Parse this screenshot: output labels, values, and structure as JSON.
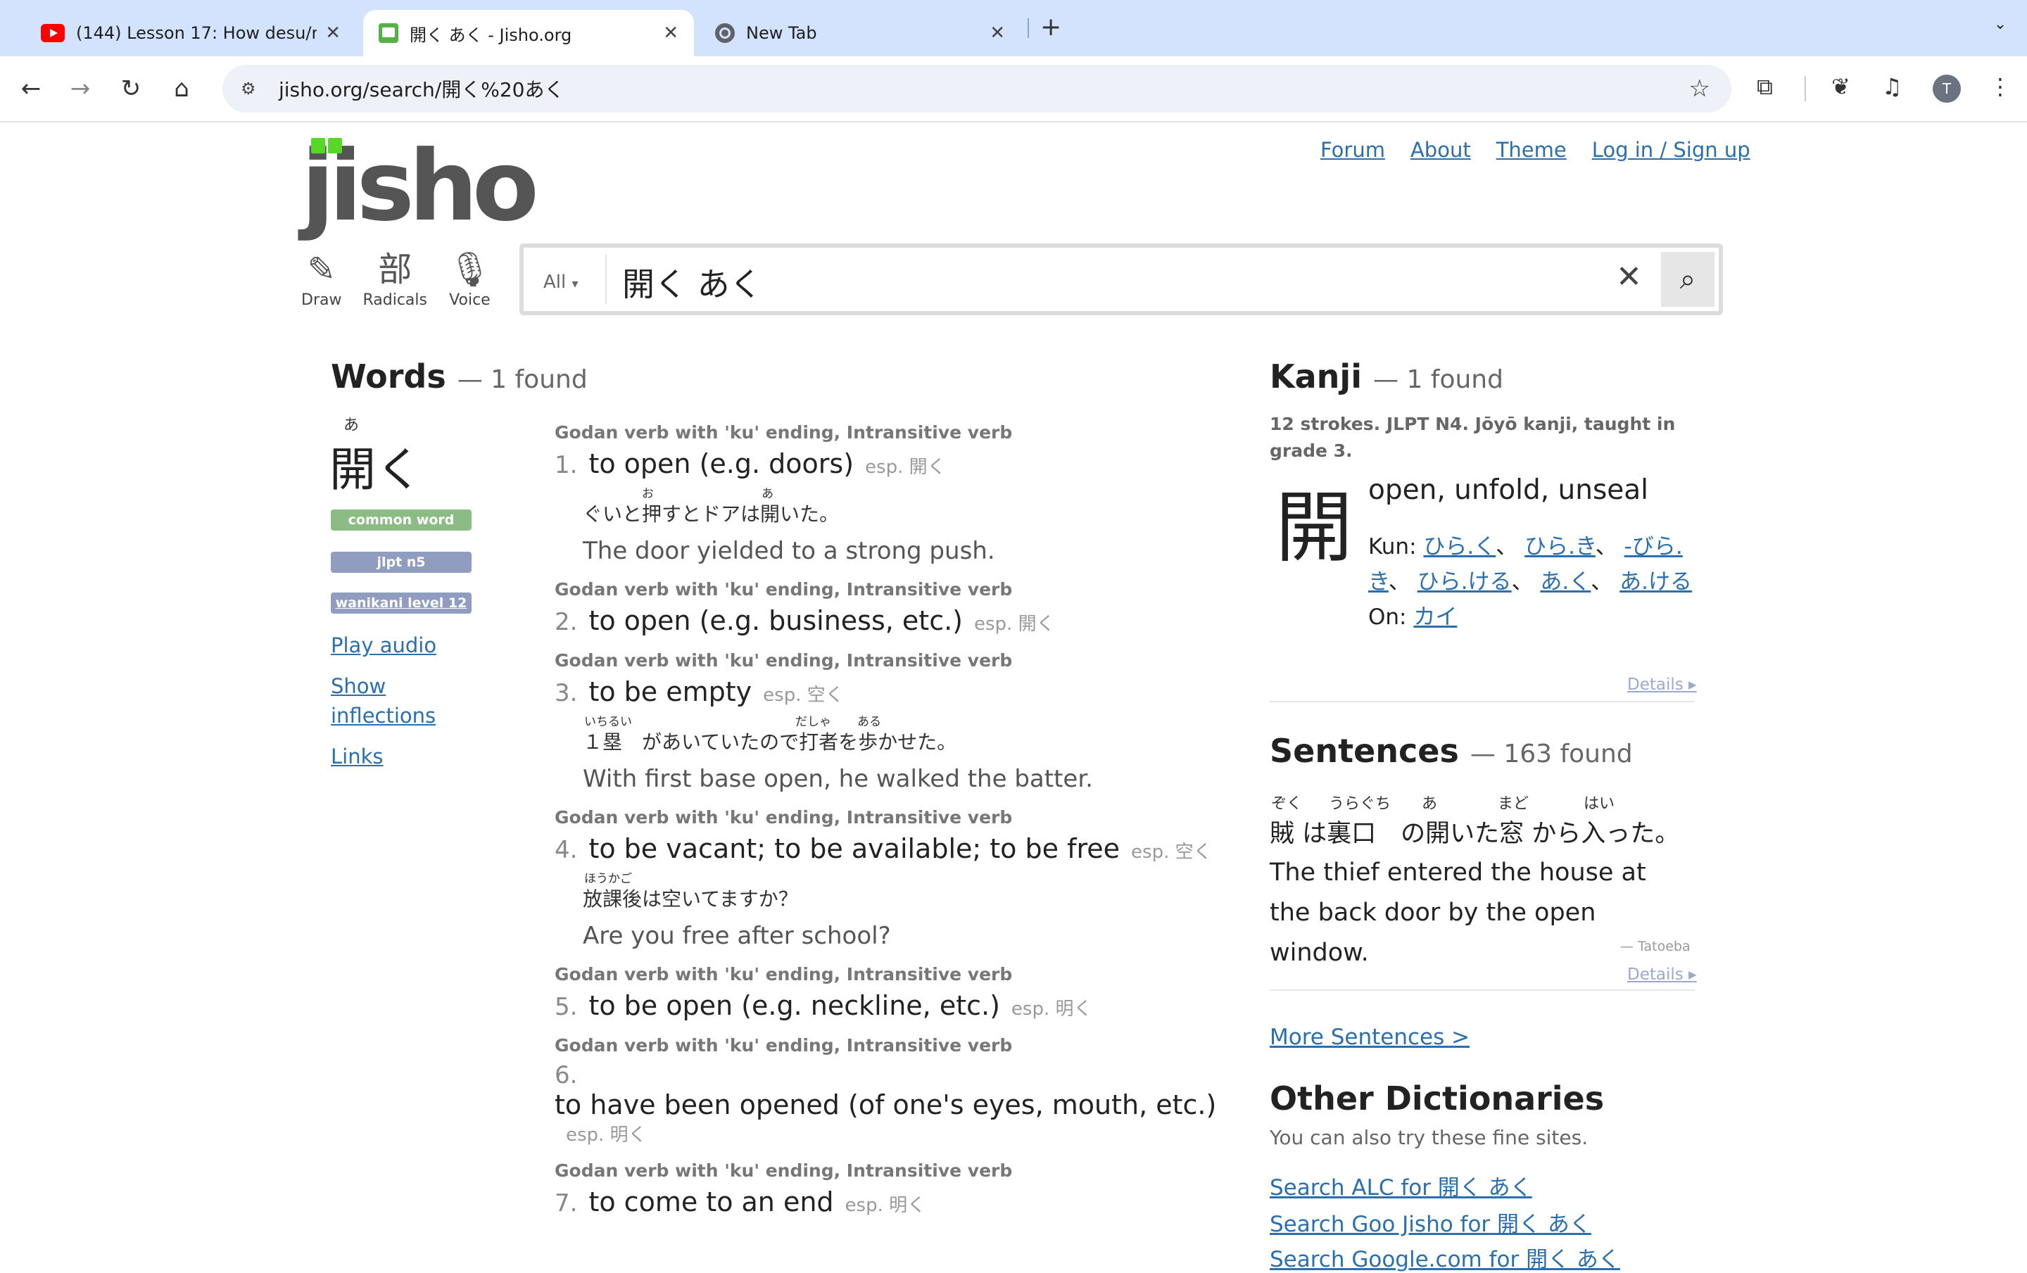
{
  "browser": {
    "tabs": [
      {
        "title": "(144) Lesson 17: How desu/m",
        "close": "✕"
      },
      {
        "title": "開く あく - Jisho.org",
        "close": "✕"
      },
      {
        "title": "New Tab",
        "close": "✕"
      }
    ],
    "new_tab": "+",
    "url": "jisho.org/search/開く%20あく",
    "avatar_letter": "T"
  },
  "site": {
    "logo": "jisho",
    "nav": [
      "Forum",
      "About",
      "Theme",
      "Log in / Sign up"
    ],
    "tools": [
      {
        "glyph": "✎",
        "label": "Draw"
      },
      {
        "glyph": "部",
        "label": "Radicals"
      },
      {
        "glyph": "🎙",
        "label": "Voice"
      }
    ],
    "search": {
      "filter": "All",
      "query": "開く あく"
    }
  },
  "words": {
    "heading": "Words",
    "count": "— 1 found",
    "furigana": "あ",
    "word": "開く",
    "tags": [
      "common word",
      "jlpt n5",
      "wanikani level 12"
    ],
    "links": [
      "Play audio",
      "Show",
      "inflections",
      "Links"
    ],
    "definitions": [
      {
        "pos": "Godan verb with 'ku' ending, Intransitive verb",
        "num": "1.",
        "meaning": "to open (e.g. doors)",
        "esp": "esp. 開く",
        "ex_jp": "ぐいと押すとドアは開いた。",
        "ex_en": "The door yielded to a strong push.",
        "ruby": [
          "お",
          "あ"
        ]
      },
      {
        "pos": "Godan verb with 'ku' ending, Intransitive verb",
        "num": "2.",
        "meaning": "to open (e.g. business, etc.)",
        "esp": "esp. 開く"
      },
      {
        "pos": "Godan verb with 'ku' ending, Intransitive verb",
        "num": "3.",
        "meaning": "to be empty",
        "esp": "esp. 空く",
        "ex_jp": "１塁　があいていたので打者を歩かせた。",
        "ex_en": "With first base open, he walked the batter.",
        "ruby": [
          "いちるい",
          "だしゃ",
          "ある"
        ]
      },
      {
        "pos": "Godan verb with 'ku' ending, Intransitive verb",
        "num": "4.",
        "meaning": "to be vacant; to be available; to be free",
        "esp": "esp. 空く",
        "ex_jp": "放課後は空いてますか？",
        "ex_en": "Are you free after school?",
        "ruby": [
          "ほうかご"
        ]
      },
      {
        "pos": "Godan verb with 'ku' ending, Intransitive verb",
        "num": "5.",
        "meaning": "to be open (e.g. neckline, etc.)",
        "esp": "esp. 明く"
      },
      {
        "pos": "Godan verb with 'ku' ending, Intransitive verb",
        "num": "6.",
        "meaning": "to have been opened (of one's eyes, mouth, etc.)",
        "esp": "esp. 明く"
      },
      {
        "pos": "Godan verb with 'ku' ending, Intransitive verb",
        "num": "7.",
        "meaning": "to come to an end",
        "esp": "esp. 明く"
      }
    ]
  },
  "kanji": {
    "heading": "Kanji",
    "count": "— 1 found",
    "info": "12 strokes. JLPT N4. Jōyō kanji, taught in grade 3.",
    "char": "開",
    "meaning": "open, unfold, unseal",
    "kun_label": "Kun:",
    "kun": [
      "ひら.く",
      "ひら.き",
      "-びら.き",
      "ひら.ける",
      "あ.く",
      "あ.ける"
    ],
    "on_label": "On:",
    "on": [
      "カイ"
    ],
    "details": "Details ▸"
  },
  "sentences": {
    "heading": "Sentences",
    "count": "— 163 found",
    "furigana": [
      "ぞく",
      "うらぐち",
      "あ",
      "まど",
      "はい"
    ],
    "japanese": "賊 は裏口　の開いた窓 から入った。",
    "english": "The thief entered the house at the back door by the open window.",
    "source": "— Tatoeba",
    "details": "Details ▸",
    "more": "More Sentences >"
  },
  "other": {
    "heading": "Other Dictionaries",
    "sub": "You can also try these fine sites.",
    "links": [
      "Search ALC for 開く あく",
      "Search Goo Jisho for 開く あく",
      "Search Google.com for 開く あく"
    ]
  }
}
